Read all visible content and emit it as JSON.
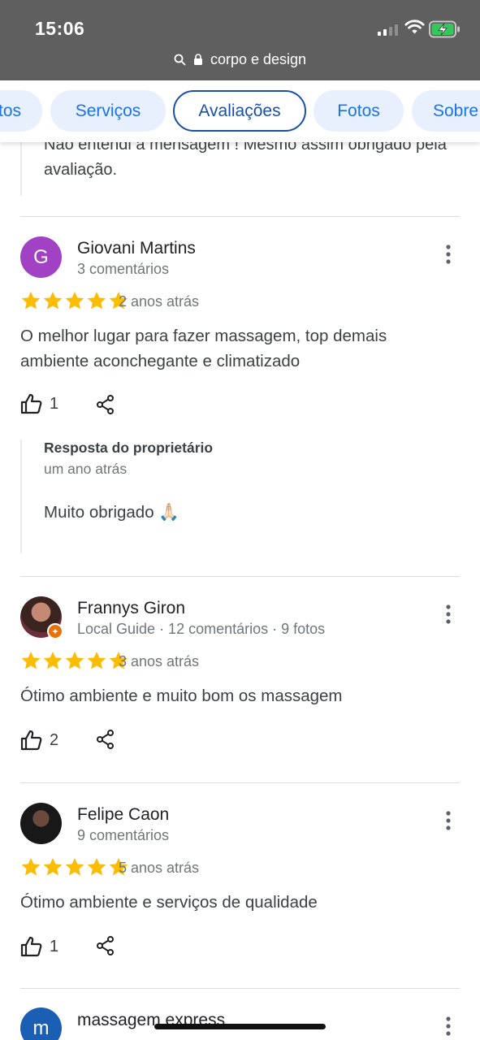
{
  "status_bar": {
    "time": "15:06"
  },
  "url_bar": {
    "site": "corpo e design"
  },
  "tabs": [
    {
      "label": "tos"
    },
    {
      "label": "Serviços"
    },
    {
      "label": "Avaliações"
    },
    {
      "label": "Fotos"
    },
    {
      "label": "Sobre"
    }
  ],
  "previous_reply": {
    "text": "Não entendi a mensagem ! Mesmo assim obrigado pela avaliação."
  },
  "reviews": [
    {
      "name": "Giovani Martins",
      "meta": "3 comentários",
      "avatar_letter": "G",
      "avatar_color": "#a142c4",
      "rating": 5,
      "when": "2 anos atrás",
      "text": "O melhor lugar para fazer massagem, top demais ambiente aconchegante e  climatizado",
      "likes": "1",
      "owner_reply": {
        "title": "Resposta do proprietário",
        "when": "um ano atrás",
        "text": "Muito obrigado 🙏🏻"
      }
    },
    {
      "name": "Frannys Giron",
      "meta": "Local Guide · 12 comentários · 9 fotos",
      "rating": 5,
      "when": "3 anos atrás",
      "text": "Ótimo ambiente e muito bom os massagem",
      "likes": "2"
    },
    {
      "name": "Felipe Caon",
      "meta": "9 comentários",
      "rating": 5,
      "when": "5 anos atrás",
      "text": "Ótimo ambiente e serviços de qualidade",
      "likes": "1"
    },
    {
      "name": "massagem express",
      "avatar_letter": "m",
      "avatar_color": "#1a5fb4"
    }
  ],
  "colors": {
    "star": "#fbbc04",
    "accent": "#1a73e8",
    "active_tab": "#1a4fa3"
  }
}
